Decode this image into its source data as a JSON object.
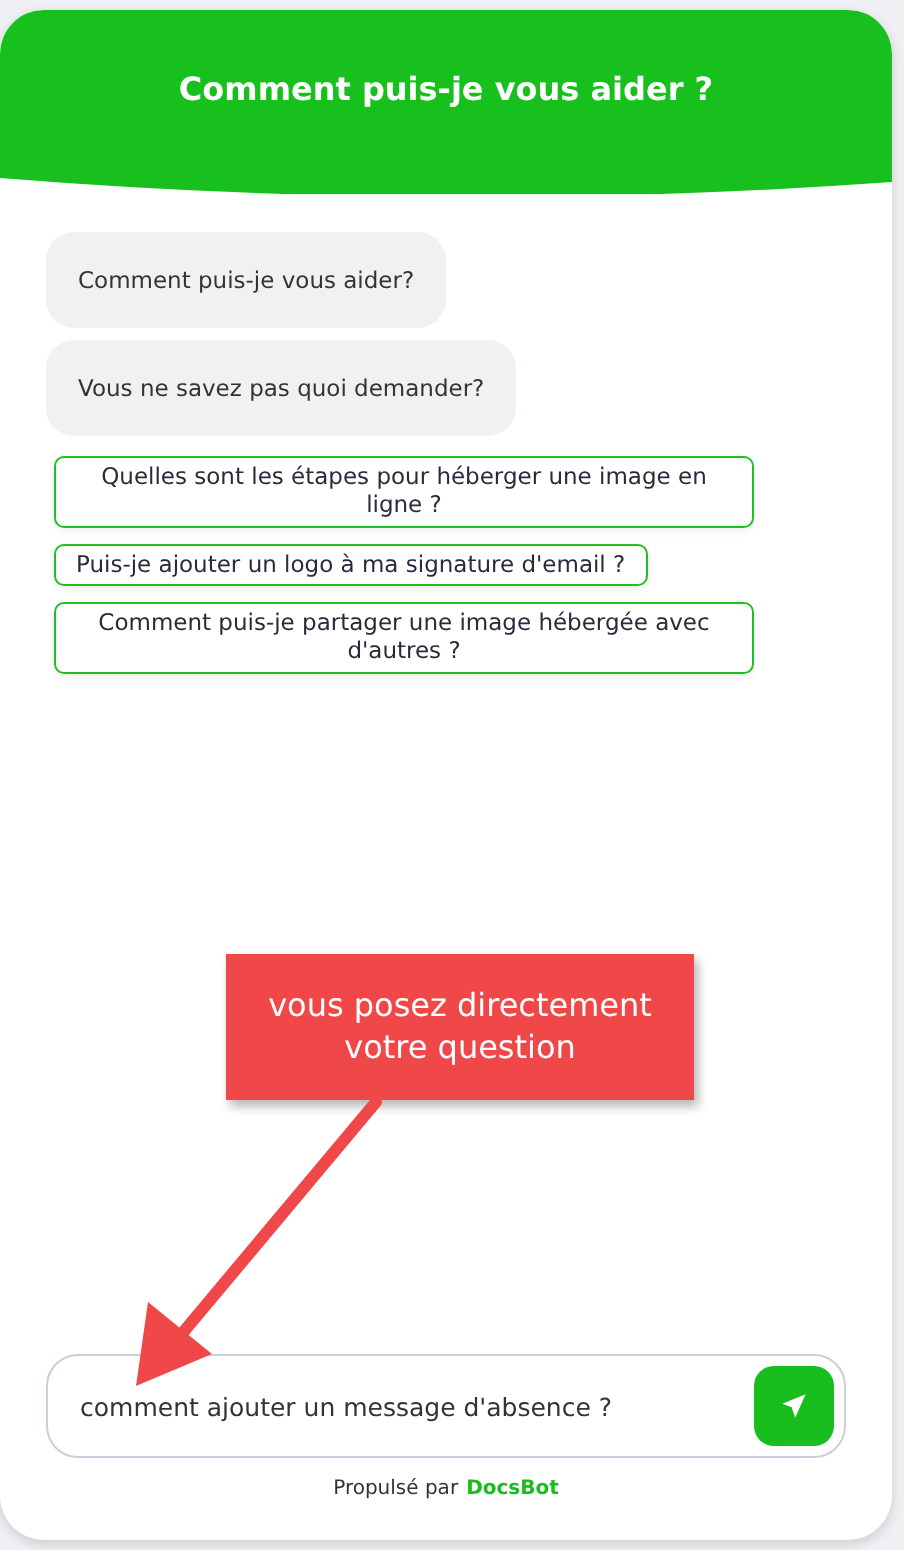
{
  "header": {
    "title": "Comment puis-je vous aider ?"
  },
  "messages": [
    {
      "text": "Comment puis-je vous aider?"
    },
    {
      "text": "Vous ne savez pas quoi demander?"
    }
  ],
  "suggestions": [
    "Quelles sont les étapes pour héberger une image en ligne ?",
    "Puis-je ajouter un logo à ma signature d'email ?",
    "Comment puis-je partager une image hébergée avec d'autres ?"
  ],
  "input": {
    "value": "comment ajouter un message d'absence ?"
  },
  "footer": {
    "prefix": "Propulsé par",
    "brand": "DocsBot"
  },
  "annotation": {
    "text": "vous posez directement votre question"
  }
}
